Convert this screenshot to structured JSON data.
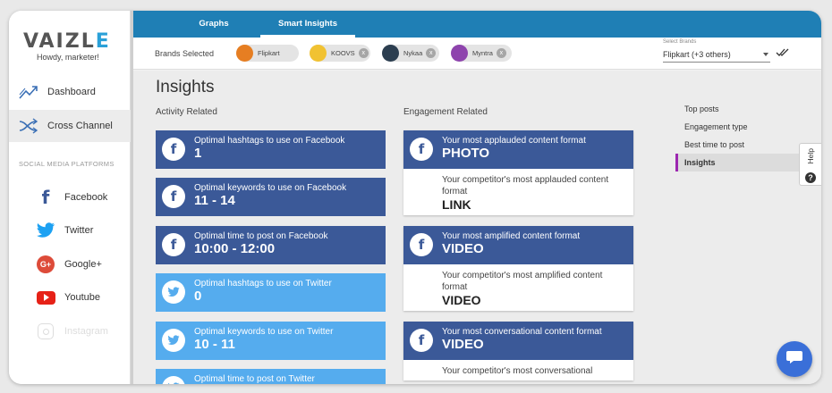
{
  "app": {
    "logo_main": "VAIZL",
    "logo_accent": "E",
    "tagline": "Howdy, marketer!"
  },
  "sidebar": {
    "nav": [
      {
        "label": "Dashboard",
        "icon": "trend-icon"
      },
      {
        "label": "Cross Channel",
        "icon": "shuffle-icon",
        "active": true
      }
    ],
    "section_label": "SOCIAL MEDIA PLATFORMS",
    "platforms": [
      {
        "label": "Facebook",
        "icon": "facebook-icon",
        "color": "#3b5998"
      },
      {
        "label": "Twitter",
        "icon": "twitter-icon",
        "color": "#1da1f2"
      },
      {
        "label": "Google+",
        "icon": "google-plus-icon",
        "color": "#dd4b39"
      },
      {
        "label": "Youtube",
        "icon": "youtube-icon",
        "color": "#e62117"
      },
      {
        "label": "Instagram",
        "icon": "instagram-icon",
        "color": "#dddddd",
        "disabled": true
      }
    ]
  },
  "topbar": {
    "tabs": [
      {
        "label": "Graphs"
      },
      {
        "label": "Smart Insights",
        "active": true
      }
    ],
    "color": "#1f7fb5"
  },
  "brands": {
    "label": "Brands Selected",
    "chips": [
      {
        "label": "Flipkart",
        "color": "#e67e22",
        "removable": false
      },
      {
        "label": "KOOVS",
        "color": "#f1c232",
        "removable": true
      },
      {
        "label": "Nykaa",
        "color": "#2c3e50",
        "removable": true
      },
      {
        "label": "Myntra",
        "color": "#8e44ad",
        "removable": true
      }
    ],
    "remove_symbol": "x",
    "select_caption": "Select Brands",
    "select_value": "Flipkart (+3 others)"
  },
  "main": {
    "title": "Insights",
    "activity_heading": "Activity Related",
    "engagement_heading": "Engagement Related",
    "activity_cards": [
      {
        "network": "facebook",
        "subtitle": "Optimal hashtags to use on Facebook",
        "value": "1"
      },
      {
        "network": "facebook",
        "subtitle": "Optimal keywords to use on Facebook",
        "value": "11 - 14"
      },
      {
        "network": "facebook",
        "subtitle": "Optimal time to post on Facebook",
        "value": "10:00 - 12:00"
      },
      {
        "network": "twitter",
        "subtitle": "Optimal hashtags to use on Twitter",
        "value": "0"
      },
      {
        "network": "twitter",
        "subtitle": "Optimal keywords to use on Twitter",
        "value": "10 - 11"
      },
      {
        "network": "twitter",
        "subtitle": "Optimal time to post on Twitter",
        "value": ""
      }
    ],
    "engagement_cards": [
      {
        "subtitle": "Your most applauded content format",
        "value": "PHOTO",
        "comp_subtitle": "Your competitor's most applauded content format",
        "comp_value": "LINK"
      },
      {
        "subtitle": "Your most amplified content format",
        "value": "VIDEO",
        "comp_subtitle": "Your competitor's most amplified content format",
        "comp_value": "VIDEO"
      },
      {
        "subtitle": "Your most conversational content format",
        "value": "VIDEO",
        "comp_subtitle": "Your competitor's most conversational",
        "comp_value": ""
      }
    ]
  },
  "right_menu": {
    "items": [
      {
        "label": "Top posts"
      },
      {
        "label": "Engagement type"
      },
      {
        "label": "Best time to post"
      },
      {
        "label": "Insights",
        "active": true
      }
    ]
  },
  "help": {
    "label": "Help",
    "icon_text": "?"
  },
  "colors": {
    "facebook": "#3b5998",
    "twitter": "#55acee",
    "accent": "#9c27b0"
  }
}
